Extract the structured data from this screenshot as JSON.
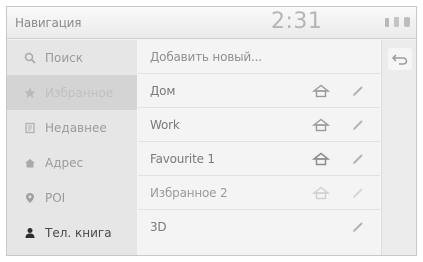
{
  "header": {
    "title": "Навигация",
    "clock": "2:31"
  },
  "sidebar": {
    "items": [
      {
        "label": "Поиск",
        "icon": "search-icon"
      },
      {
        "label": "Избранное",
        "icon": "star-icon"
      },
      {
        "label": "Недавнее",
        "icon": "recent-icon"
      },
      {
        "label": "Адрес",
        "icon": "address-icon"
      },
      {
        "label": "POI",
        "icon": "poi-icon"
      },
      {
        "label": "Тел. книга",
        "icon": "person-icon"
      }
    ]
  },
  "list": {
    "add_label": "Добавить новый...",
    "rows": [
      {
        "label": "Дом"
      },
      {
        "label": "Work"
      },
      {
        "label": "Favourite 1"
      },
      {
        "label": "Избранное 2"
      },
      {
        "label": "3D"
      }
    ]
  },
  "rail": {
    "back_icon": "back-arrow-icon"
  },
  "colors": {
    "background": "#f4f4f4",
    "sidebar": "#e6e6e6",
    "sidebar_active": "#d4d4d4",
    "text": "#7a7a7a"
  }
}
